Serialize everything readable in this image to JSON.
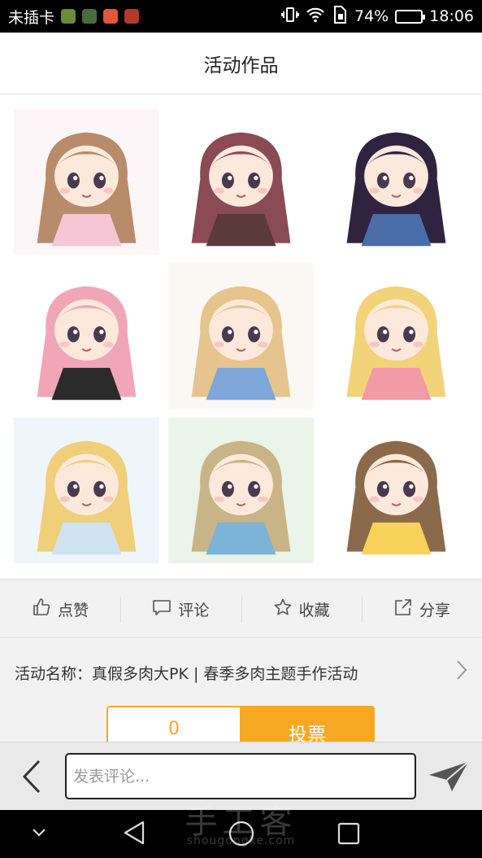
{
  "status_bar": {
    "carrier": "未插卡",
    "battery": "74%",
    "battery_level": 0.74,
    "time": "18:06",
    "app_icon_colors": [
      "#6b8c3a",
      "#4a6b3c",
      "#e2563a",
      "#b03a2e"
    ]
  },
  "header": {
    "title": "活动作品"
  },
  "gallery": {
    "items": [
      {
        "icon": "chibi-girls-pastel-image",
        "bg": "#fdf6f8",
        "hair": "#b88b6b",
        "dress": "#f5c6d6"
      },
      {
        "icon": "chibi-girl-brown-hair-image",
        "bg": "#ffffff",
        "hair": "#8a4b55",
        "dress": "#5b3a3a"
      },
      {
        "icon": "chibi-girl-blue-dress-image",
        "bg": "#ffffff",
        "hair": "#2f2340",
        "dress": "#4a6fa8"
      },
      {
        "icon": "chibi-girl-pink-hair-image",
        "bg": "#ffffff",
        "hair": "#f1a6b8",
        "dress": "#2b2b2b"
      },
      {
        "icon": "chibi-girl-blonde-sailor-image",
        "bg": "#fbf8f4",
        "hair": "#e5c48e",
        "dress": "#7ea6d8"
      },
      {
        "icon": "chibi-kids-apple-image",
        "bg": "#ffffff",
        "hair": "#f3d37a",
        "dress": "#f29aa5"
      },
      {
        "icon": "chibi-girl-cat-hood-image",
        "bg": "#eef6fb",
        "hair": "#f0cf7a",
        "dress": "#cfe3f3"
      },
      {
        "icon": "chibi-catgirl-green-image",
        "bg": "#eaf4e8",
        "hair": "#c8b486",
        "dress": "#7cb3d8"
      },
      {
        "icon": "chibi-girl-yellow-sweater-image",
        "bg": "#ffffff",
        "hair": "#8a6a4a",
        "dress": "#f7d25a"
      }
    ]
  },
  "actions": [
    {
      "label": "点赞",
      "icon": "thumbs-up-icon"
    },
    {
      "label": "评论",
      "icon": "comment-icon"
    },
    {
      "label": "收藏",
      "icon": "star-icon"
    },
    {
      "label": "分享",
      "icon": "share-icon"
    }
  ],
  "activity": {
    "label": "活动名称：真假多肉大PK | 春季多肉主题手作活动",
    "icon": "chevron-right-icon"
  },
  "vote": {
    "count": "0",
    "button_label": "投票",
    "accent": "#f7a823"
  },
  "comment_bar": {
    "placeholder": "发表评论..."
  },
  "watermark": {
    "title": "手工客",
    "url": "shougongke.com"
  }
}
